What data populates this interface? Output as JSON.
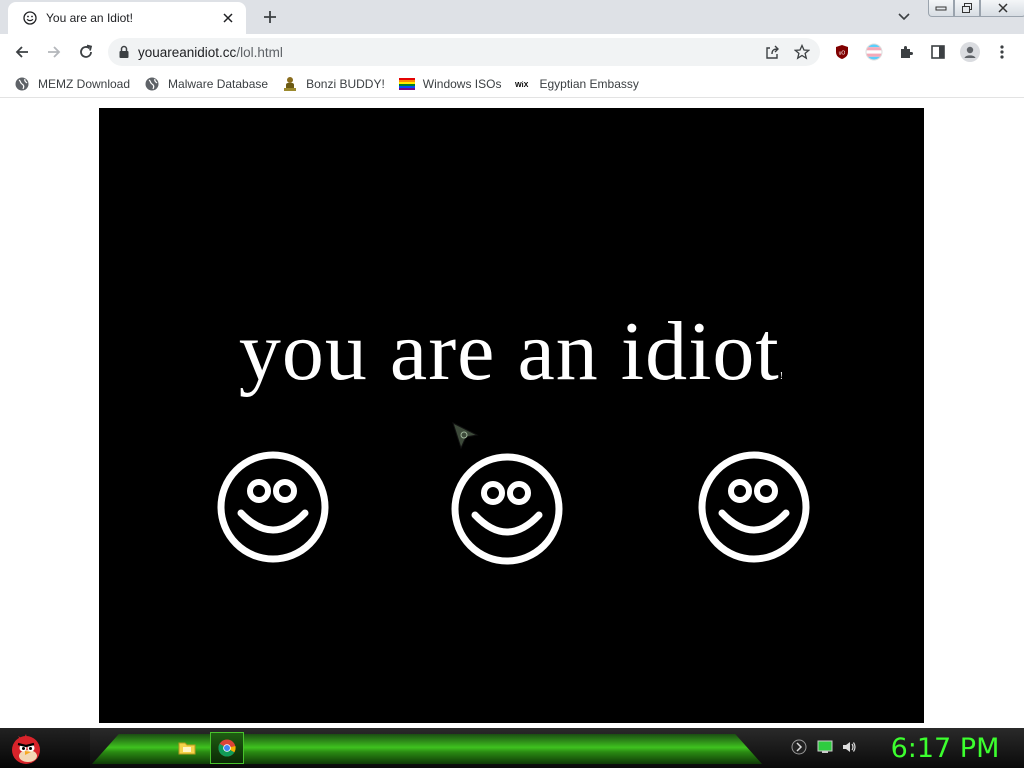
{
  "browser": {
    "tab": {
      "title": "You are an Idiot!",
      "favicon": "smiley-icon"
    },
    "url": {
      "host": "youareanidiot.cc",
      "path": "/lol.html"
    },
    "bookmarks": [
      {
        "label": "MEMZ Download",
        "icon": "globe-icon"
      },
      {
        "label": "Malware Database",
        "icon": "globe-icon"
      },
      {
        "label": "Bonzi BUDDY!",
        "icon": "bonzi-icon"
      },
      {
        "label": "Windows ISOs",
        "icon": "rainbow-flag-icon"
      },
      {
        "label": "Egyptian Embassy",
        "icon": "wix-icon"
      }
    ],
    "extensions": [
      "ublock-icon",
      "trans-flag-icon",
      "puzzle-icon",
      "side-panel-icon",
      "profile-icon",
      "more-vert-icon"
    ]
  },
  "page": {
    "headline": "you are an idiot",
    "headline_suffix": "!",
    "smiley_count": 3,
    "background": "#000000",
    "foreground": "#ffffff"
  },
  "taskbar": {
    "clock": "6:17 PM",
    "accent": "#3cff2e",
    "apps": [
      "file-explorer-icon",
      "chrome-icon"
    ],
    "tray": [
      "keyboard-icon",
      "network-icon",
      "volume-icon"
    ]
  }
}
